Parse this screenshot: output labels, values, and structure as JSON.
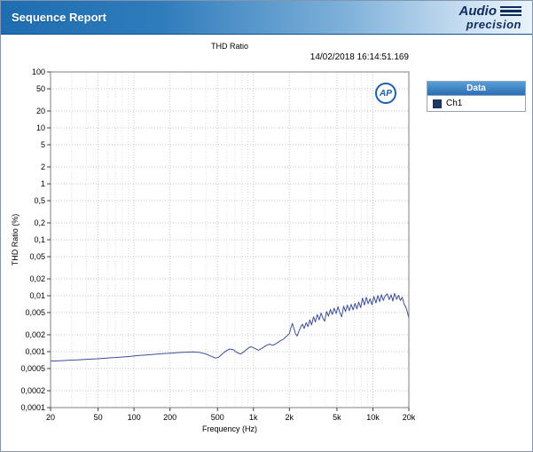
{
  "window": {
    "title": "Sequence Report"
  },
  "brand": {
    "word_top": "Audio",
    "word_bottom": "precision",
    "badge": "AP"
  },
  "colors": {
    "header_blue": "#1e6db1",
    "line": "#3d4f96",
    "legend_swatch": "#1f3864",
    "logo_navy": "#0f2d5c"
  },
  "chart_data": {
    "type": "line",
    "title": "THD Ratio",
    "timestamp": "14/02/2018 16:14:51.169",
    "xlabel": "Frequency (Hz)",
    "ylabel": "THD Ratio (%)",
    "x_scale": "log",
    "y_scale": "log",
    "xlim": [
      20,
      20000
    ],
    "ylim": [
      0.0001,
      100
    ],
    "grid": true,
    "x_ticks": [
      {
        "v": 20,
        "label": "20"
      },
      {
        "v": 50,
        "label": "50"
      },
      {
        "v": 100,
        "label": "100"
      },
      {
        "v": 200,
        "label": "200"
      },
      {
        "v": 500,
        "label": "500"
      },
      {
        "v": 1000,
        "label": "1k"
      },
      {
        "v": 2000,
        "label": "2k"
      },
      {
        "v": 5000,
        "label": "5k"
      },
      {
        "v": 10000,
        "label": "10k"
      },
      {
        "v": 20000,
        "label": "20k"
      }
    ],
    "x_minor": [
      30,
      40,
      60,
      70,
      80,
      90,
      300,
      400,
      600,
      700,
      800,
      900,
      3000,
      4000,
      6000,
      7000,
      8000,
      9000
    ],
    "y_ticks": [
      {
        "v": 100,
        "label": "100"
      },
      {
        "v": 50,
        "label": "50"
      },
      {
        "v": 20,
        "label": "20"
      },
      {
        "v": 10,
        "label": "10"
      },
      {
        "v": 5,
        "label": "5"
      },
      {
        "v": 2,
        "label": "2"
      },
      {
        "v": 1,
        "label": "1"
      },
      {
        "v": 0.5,
        "label": "0,5"
      },
      {
        "v": 0.2,
        "label": "0,2"
      },
      {
        "v": 0.1,
        "label": "0,1"
      },
      {
        "v": 0.05,
        "label": "0,05"
      },
      {
        "v": 0.02,
        "label": "0,02"
      },
      {
        "v": 0.01,
        "label": "0,01"
      },
      {
        "v": 0.005,
        "label": "0,005"
      },
      {
        "v": 0.002,
        "label": "0,002"
      },
      {
        "v": 0.001,
        "label": "0,001"
      },
      {
        "v": 0.0005,
        "label": "0,0005"
      },
      {
        "v": 0.0002,
        "label": "0,0002"
      },
      {
        "v": 0.0001,
        "label": "0,0001"
      }
    ],
    "legend": {
      "header": "Data",
      "position": "right",
      "entries": [
        {
          "label": "Ch1",
          "color": "#1f3864"
        }
      ]
    },
    "series": [
      {
        "name": "Ch1",
        "color": "#3d4f96",
        "points": [
          [
            20,
            0.00068
          ],
          [
            24,
            0.00069
          ],
          [
            28,
            0.0007
          ],
          [
            34,
            0.000715
          ],
          [
            40,
            0.00073
          ],
          [
            48,
            0.000745
          ],
          [
            56,
            0.00076
          ],
          [
            66,
            0.00078
          ],
          [
            78,
            0.0008
          ],
          [
            92,
            0.00082
          ],
          [
            108,
            0.00085
          ],
          [
            126,
            0.00087
          ],
          [
            148,
            0.000895
          ],
          [
            172,
            0.00092
          ],
          [
            200,
            0.00094
          ],
          [
            232,
            0.00096
          ],
          [
            268,
            0.00098
          ],
          [
            308,
            0.00099
          ],
          [
            352,
            0.00097
          ],
          [
            400,
            0.00091
          ],
          [
            440,
            0.00083
          ],
          [
            480,
            0.00077
          ],
          [
            510,
            0.00079
          ],
          [
            545,
            0.0009
          ],
          [
            585,
            0.00102
          ],
          [
            630,
            0.00111
          ],
          [
            680,
            0.00108
          ],
          [
            730,
            0.00096
          ],
          [
            780,
            0.00091
          ],
          [
            830,
            0.00099
          ],
          [
            890,
            0.00113
          ],
          [
            950,
            0.00123
          ],
          [
            1020,
            0.00115
          ],
          [
            1100,
            0.00106
          ],
          [
            1180,
            0.00115
          ],
          [
            1270,
            0.00128
          ],
          [
            1360,
            0.00136
          ],
          [
            1460,
            0.0013
          ],
          [
            1570,
            0.00142
          ],
          [
            1680,
            0.00156
          ],
          [
            1800,
            0.0017
          ],
          [
            1900,
            0.0019
          ],
          [
            2000,
            0.0021
          ],
          [
            2060,
            0.0027
          ],
          [
            2120,
            0.0032
          ],
          [
            2180,
            0.0026
          ],
          [
            2250,
            0.0021
          ],
          [
            2320,
            0.0019
          ],
          [
            2400,
            0.0023
          ],
          [
            2480,
            0.0027
          ],
          [
            2570,
            0.0031
          ],
          [
            2660,
            0.0026
          ],
          [
            2760,
            0.0033
          ],
          [
            2860,
            0.0028
          ],
          [
            2960,
            0.0037
          ],
          [
            3070,
            0.003
          ],
          [
            3180,
            0.0042
          ],
          [
            3300,
            0.0034
          ],
          [
            3420,
            0.0046
          ],
          [
            3550,
            0.0037
          ],
          [
            3680,
            0.0049
          ],
          [
            3810,
            0.004
          ],
          [
            3950,
            0.0035
          ],
          [
            4100,
            0.0052
          ],
          [
            4250,
            0.0043
          ],
          [
            4410,
            0.0057
          ],
          [
            4570,
            0.0046
          ],
          [
            4740,
            0.006
          ],
          [
            4920,
            0.0048
          ],
          [
            5100,
            0.0063
          ],
          [
            5290,
            0.005
          ],
          [
            5480,
            0.0042
          ],
          [
            5690,
            0.0065
          ],
          [
            5900,
            0.0052
          ],
          [
            6120,
            0.0068
          ],
          [
            6350,
            0.0054
          ],
          [
            6580,
            0.007
          ],
          [
            6830,
            0.0056
          ],
          [
            7080,
            0.0073
          ],
          [
            7340,
            0.0058
          ],
          [
            7610,
            0.0077
          ],
          [
            7900,
            0.0061
          ],
          [
            8190,
            0.0091
          ],
          [
            8490,
            0.0068
          ],
          [
            8810,
            0.0094
          ],
          [
            9130,
            0.0072
          ],
          [
            9470,
            0.0088
          ],
          [
            9820,
            0.0069
          ],
          [
            10200,
            0.0097
          ],
          [
            10600,
            0.0074
          ],
          [
            11000,
            0.0101
          ],
          [
            11400,
            0.0078
          ],
          [
            11800,
            0.0105
          ],
          [
            12200,
            0.0082
          ],
          [
            12700,
            0.01
          ],
          [
            13200,
            0.0108
          ],
          [
            13700,
            0.0085
          ],
          [
            14200,
            0.0104
          ],
          [
            14700,
            0.008
          ],
          [
            15200,
            0.011
          ],
          [
            15800,
            0.0086
          ],
          [
            16400,
            0.0102
          ],
          [
            17000,
            0.0082
          ],
          [
            17600,
            0.0094
          ],
          [
            18200,
            0.0072
          ],
          [
            18900,
            0.0062
          ],
          [
            19400,
            0.0052
          ],
          [
            20000,
            0.004
          ]
        ]
      }
    ]
  }
}
